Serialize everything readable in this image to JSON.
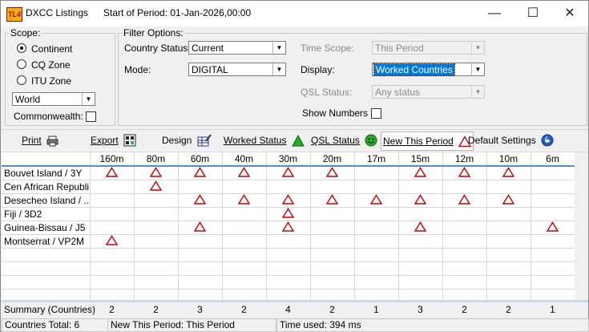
{
  "window": {
    "title": "DXCC Listings",
    "period_label": "Start of Period: 01-Jan-2026,00:00",
    "minimize": "—",
    "maximize": "☐",
    "close": "✕",
    "app_icon_text": "TL4"
  },
  "scope": {
    "label": "Scope:",
    "options": [
      "Continent",
      "CQ Zone",
      "ITU Zone"
    ],
    "selected": "Continent",
    "region_value": "World",
    "commonwealth_label": "Commonwealth:"
  },
  "filters": {
    "label": "Filter Options:",
    "country_status_label": "Country Status:",
    "country_status_value": "Current",
    "mode_label": "Mode:",
    "mode_value": "DIGITAL",
    "time_scope_label": "Time Scope:",
    "time_scope_value": "This Period",
    "display_label": "Display:",
    "display_value": "Worked Countries",
    "qsl_status_label": "QSL Status:",
    "qsl_status_value": "Any status",
    "show_numbers_label": "Show Numbers"
  },
  "toolbar": {
    "print": "Print",
    "export": "Export",
    "design": "Design",
    "worked_status": "Worked Status",
    "qsl_status": "QSL Status",
    "new_this_period": "New This Period",
    "default_settings": "Default Settings"
  },
  "grid": {
    "bands": [
      "160m",
      "80m",
      "60m",
      "40m",
      "30m",
      "20m",
      "17m",
      "15m",
      "12m",
      "10m",
      "6m"
    ],
    "rows": [
      {
        "name": "Bouvet Island / 3Y",
        "marks": [
          1,
          1,
          1,
          1,
          1,
          1,
          0,
          1,
          1,
          1,
          0
        ]
      },
      {
        "name": "Cen African Republi...",
        "marks": [
          0,
          1,
          0,
          0,
          0,
          0,
          0,
          0,
          0,
          0,
          0
        ]
      },
      {
        "name": "Desecheo Island / ...",
        "marks": [
          0,
          0,
          1,
          1,
          1,
          1,
          1,
          1,
          1,
          1,
          0
        ]
      },
      {
        "name": "Fiji / 3D2",
        "marks": [
          0,
          0,
          0,
          0,
          1,
          0,
          0,
          0,
          0,
          0,
          0
        ]
      },
      {
        "name": "Guinea-Bissau / J5",
        "marks": [
          0,
          0,
          1,
          0,
          1,
          0,
          0,
          1,
          0,
          0,
          1
        ]
      },
      {
        "name": "Montserrat / VP2M",
        "marks": [
          1,
          0,
          0,
          0,
          0,
          0,
          0,
          0,
          0,
          0,
          0
        ]
      }
    ],
    "empty_rows": 4,
    "summary_label": "Summary (Countries)",
    "summary_values": [
      "2",
      "2",
      "3",
      "2",
      "4",
      "2",
      "1",
      "3",
      "2",
      "2",
      "1"
    ]
  },
  "status": {
    "countries_total": "Countries Total: 6",
    "new_this_period": "New This Period: This Period",
    "time_used": "Time used: 394 ms"
  },
  "colors": {
    "mark_red": "#cc0000",
    "selection_blue": "#0078d7",
    "header_rule": "#4a90d0"
  }
}
